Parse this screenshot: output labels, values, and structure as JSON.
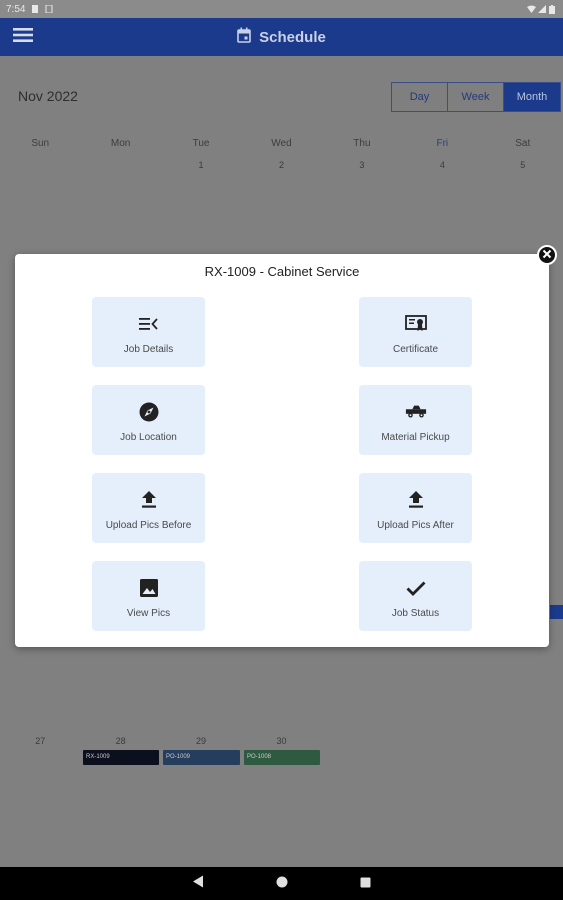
{
  "status_bar": {
    "time": "7:54"
  },
  "app_bar": {
    "title": "Schedule",
    "menu_icon": "hamburger-menu-icon",
    "title_icon": "calendar-icon",
    "color": "#1c3a8c"
  },
  "calendar": {
    "month_label": "Nov 2022",
    "views": [
      {
        "label": "Day",
        "active": false
      },
      {
        "label": "Week",
        "active": false
      },
      {
        "label": "Month",
        "active": true
      }
    ],
    "weekdays": [
      "Sun",
      "Mon",
      "Tue",
      "Wed",
      "Thu",
      "Fri",
      "Sat"
    ],
    "first_week_days": [
      "",
      "",
      "1",
      "2",
      "3",
      "4",
      "5"
    ],
    "last_week_days": [
      "27",
      "28",
      "29",
      "30"
    ],
    "events": [
      {
        "label": "RX-1009",
        "color": "#0b0f1e"
      },
      {
        "label": "PO-1009",
        "color": "#253e5e"
      },
      {
        "label": "PO-1008",
        "color": "#2e5a42"
      }
    ]
  },
  "dialog": {
    "title": "RX-1009 - Cabinet Service",
    "close_icon": "close-icon",
    "actions": [
      {
        "label": "Job Details",
        "icon": "list-details-icon"
      },
      {
        "label": "Certificate",
        "icon": "certificate-icon"
      },
      {
        "label": "Job Location",
        "icon": "compass-icon"
      },
      {
        "label": "Material Pickup",
        "icon": "truck-icon"
      },
      {
        "label": "Upload Pics Before",
        "icon": "upload-icon"
      },
      {
        "label": "Upload Pics After",
        "icon": "upload-icon"
      },
      {
        "label": "View Pics",
        "icon": "image-icon"
      },
      {
        "label": "Job Status",
        "icon": "checkmark-icon"
      }
    ]
  },
  "nav_bar": {
    "back_icon": "back-triangle-icon",
    "home_icon": "home-circle-icon",
    "recents_icon": "recents-square-icon"
  }
}
